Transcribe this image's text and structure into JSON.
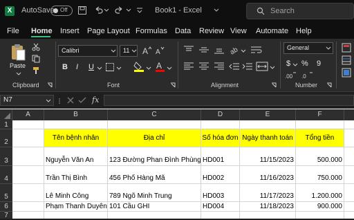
{
  "app": {
    "logo_letter": "X",
    "autosave_label": "AutoSave",
    "autosave_state": "Off",
    "title": "Book1 - Excel",
    "search_placeholder": "Search"
  },
  "menu_tabs": [
    "File",
    "Home",
    "Insert",
    "Page Layout",
    "Formulas",
    "Data",
    "Review",
    "View",
    "Automate",
    "Help"
  ],
  "active_tab": "Home",
  "ribbon": {
    "clipboard": {
      "paste_label": "Paste",
      "group_label": "Clipboard"
    },
    "font": {
      "font_name": "Calibri",
      "font_size": "11",
      "group_label": "Font",
      "bold": "B",
      "italic": "I",
      "underline": "U",
      "fill_color": "#ffff00",
      "font_color": "#ff0000"
    },
    "alignment": {
      "group_label": "Alignment"
    },
    "number": {
      "format": "General",
      "group_label": "Number",
      "currency": "$",
      "percent": "%",
      "comma": "9"
    }
  },
  "formula_bar": {
    "name_box": "N7",
    "fx": "fx",
    "value": ""
  },
  "grid": {
    "columns": [
      "A",
      "B",
      "C",
      "D",
      "E",
      "F"
    ],
    "rows": [
      "1",
      "2",
      "3",
      "4",
      "5",
      "6",
      "7"
    ],
    "header_fill": "#ffff00",
    "headers": [
      "Tên bệnh nhân",
      "Địa chỉ",
      "Số hóa đơn",
      "Ngày thanh toán",
      "Tổng tiền"
    ],
    "records": [
      [
        "Nguyễn Văn An",
        "123 Đường Phan Đình Phùng",
        "HD001",
        "11/15/2023",
        "500.000"
      ],
      [
        "Trần Thị Bình",
        "456 Phố Hàng Mã",
        "HD002",
        "11/16/2023",
        "750.000"
      ],
      [
        "Lê Minh Công",
        "789 Ngõ Minh Trung",
        "HD003",
        "11/17/2023",
        "1.200.000"
      ],
      [
        "Phạm Thanh Duyên",
        "101 Cầu GHI",
        "HD004",
        "11/18/2023",
        "900.000"
      ]
    ]
  }
}
